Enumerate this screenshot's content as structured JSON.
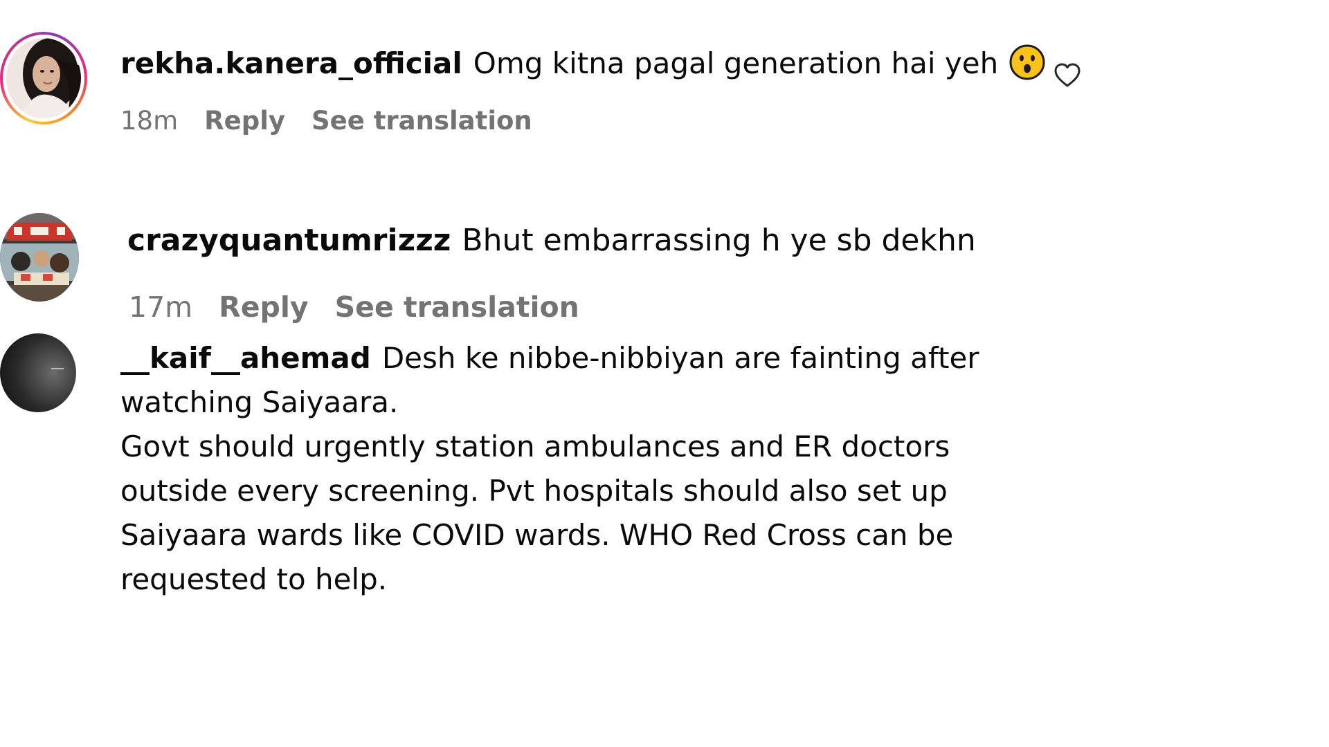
{
  "comments": [
    {
      "username": "rekha.kanera_official",
      "text": "Omg kitna pagal generation hai yeh",
      "emoji": "hushed-face-emoji",
      "time": "18m",
      "reply": "Reply",
      "translate": "See translation",
      "has_story_ring": true
    },
    {
      "username": "crazyquantumrizzz",
      "text": "Bhut embarrassing h ye sb dekhn",
      "time": "17m",
      "reply": "Reply",
      "translate": "See translation"
    },
    {
      "username": "__kaif__ahemad",
      "lines": [
        "Desh ke nibbe-nibbiyan are fainting after",
        "watching Saiyaara.",
        "Govt should urgently station ambulances and ER doctors",
        "outside every screening. Pvt hospitals should also set up",
        "Saiyaara wards like COVID wards. WHO Red Cross can be",
        "requested to help."
      ]
    }
  ],
  "icons": {
    "like": "heart-outline-icon"
  },
  "colors": {
    "text": "#0a0a0a",
    "muted": "#737373",
    "background": "#ffffff"
  }
}
